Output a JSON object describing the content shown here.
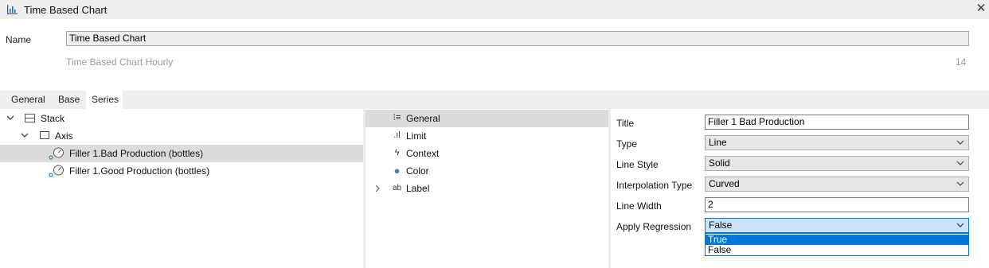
{
  "window": {
    "title": "Time Based Chart",
    "close_glyph": "✕",
    "icon": "bar-chart-icon"
  },
  "name_section": {
    "label": "Name",
    "value": "Time Based Chart",
    "subtitle": "Time Based Chart Hourly",
    "count": "14"
  },
  "tabs": [
    {
      "label": "General",
      "active": false
    },
    {
      "label": "Base",
      "active": false
    },
    {
      "label": "Series",
      "active": true
    }
  ],
  "tree": {
    "items": [
      {
        "label": "Stack",
        "icon": "stack-icon",
        "expanded": true
      },
      {
        "label": "Axis",
        "icon": "axis-icon",
        "expanded": true
      },
      {
        "label": "Filler 1.Bad Production (bottles)",
        "icon": "tag-gauge-icon",
        "selected": true
      },
      {
        "label": "Filler 1.Good Production (bottles)",
        "icon": "tag-gauge-icon",
        "selected": false
      }
    ]
  },
  "categories": [
    {
      "label": "General",
      "icon": "list-icon",
      "glyph": "⁝≡",
      "selected": true
    },
    {
      "label": "Limit",
      "icon": "limit-icon",
      "glyph": ".ıl",
      "selected": false
    },
    {
      "label": "Context",
      "icon": "lightning-icon",
      "glyph": "ϟ",
      "selected": false
    },
    {
      "label": "Color",
      "icon": "color-dot-icon",
      "glyph": "●",
      "selected": false
    },
    {
      "label": "Label",
      "icon": "text-label-icon",
      "glyph": "ab",
      "selected": false,
      "expandable": true
    }
  ],
  "properties": {
    "title": {
      "label": "Title",
      "value": "Filler 1 Bad Production"
    },
    "type": {
      "label": "Type",
      "value": "Line"
    },
    "line_style": {
      "label": "Line Style",
      "value": "Solid"
    },
    "interpolation_type": {
      "label": "Interpolation Type",
      "value": "Curved"
    },
    "line_width": {
      "label": "Line Width",
      "value": "2"
    },
    "apply_regression": {
      "label": "Apply Regression",
      "value": "False",
      "open": true,
      "options": [
        "True",
        "False"
      ],
      "highlighted": "True"
    }
  },
  "colors": {
    "accent": "#0078d7",
    "selection": "#dcdcdc",
    "chrome": "#eeeeee",
    "color_swatch": "#4a7bb5"
  }
}
